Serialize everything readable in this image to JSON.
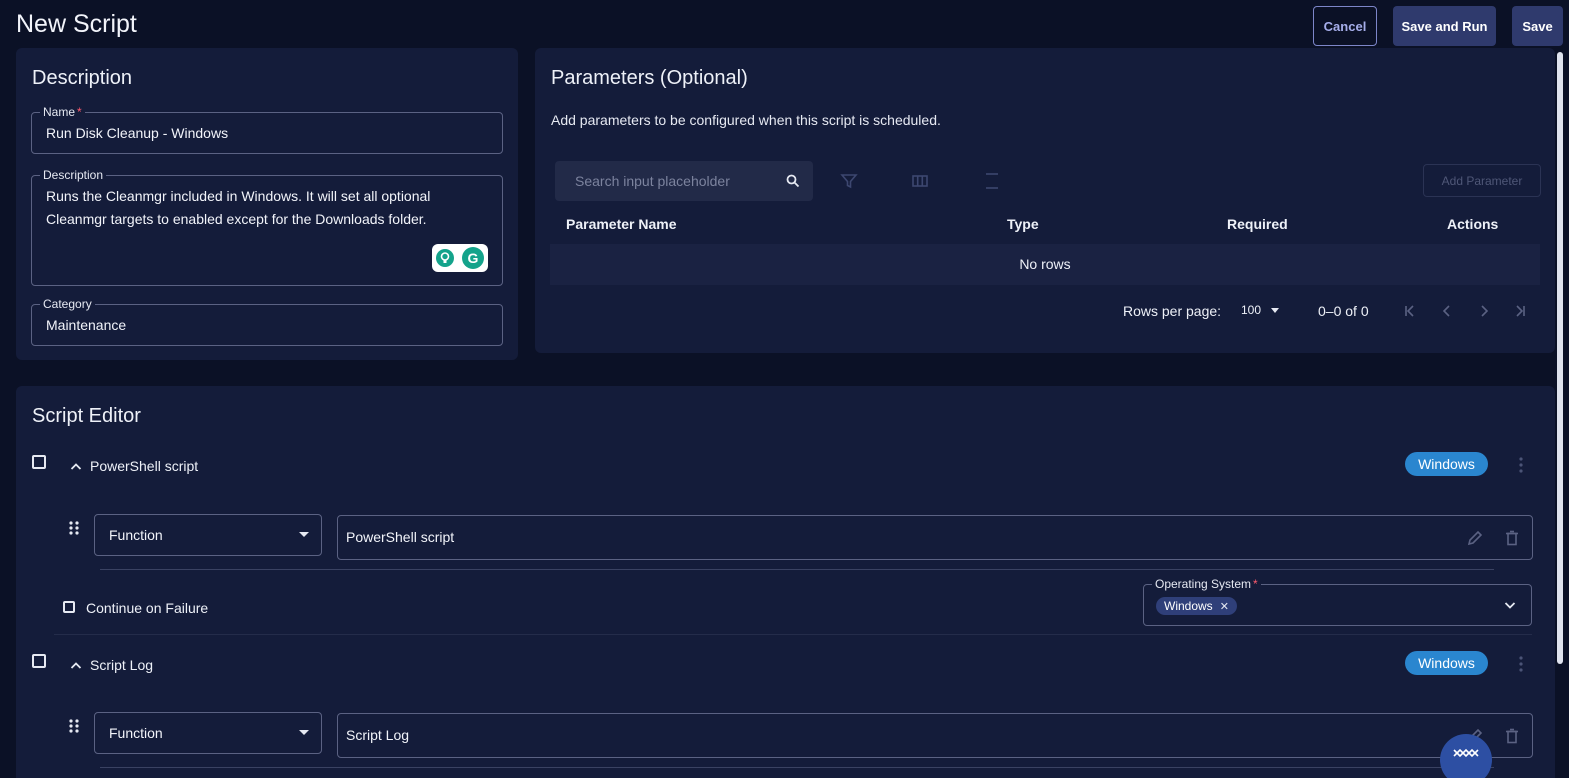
{
  "header": {
    "title": "New Script",
    "cancel_label": "Cancel",
    "save_and_run_label": "Save and Run",
    "save_label": "Save"
  },
  "description_card": {
    "title": "Description",
    "name_label": "Name",
    "required_mark": "*",
    "name_value": "Run Disk Cleanup - Windows",
    "description_label": "Description",
    "description_line1": "Runs the Cleanmgr included in Windows. It will set all optional",
    "description_line2": "Cleanmgr targets to enabled except for the Downloads folder.",
    "category_label": "Category",
    "category_value": "Maintenance",
    "grammarly_letter": "G"
  },
  "parameters_card": {
    "title": "Parameters (Optional)",
    "subtitle": "Add parameters to be configured when this script is scheduled.",
    "search_placeholder": "Search input placeholder",
    "add_parameter_label": "Add Parameter",
    "columns": [
      "Parameter Name",
      "Type",
      "Required",
      "Actions"
    ],
    "empty_text": "No rows",
    "rows_per_page_label": "Rows per page:",
    "rows_per_page_value": "100",
    "range_text": "0–0 of 0"
  },
  "script_editor": {
    "title": "Script Editor",
    "items": [
      {
        "title": "PowerShell script",
        "badge": "Windows",
        "type_value": "Function",
        "name_value": "PowerShell script",
        "continue_on_failure_label": "Continue on Failure",
        "os_label": "Operating System",
        "os_chip": "Windows"
      },
      {
        "title": "Script Log",
        "badge": "Windows",
        "type_value": "Function",
        "name_value": "Script Log"
      }
    ]
  },
  "colors": {
    "background": "#0b1126",
    "card": "#141c3a",
    "primary_button": "#2f3a6d",
    "badge": "#2a86cf",
    "chip": "#2f3f79",
    "required": "#ff5b6e"
  },
  "icons": {
    "search": "search-icon",
    "filter": "filter-icon",
    "columns": "columns-icon",
    "density": "density-icon",
    "first_page": "first-page-icon",
    "prev_page": "prev-page-icon",
    "next_page": "next-page-icon",
    "last_page": "last-page-icon",
    "drag": "drag-handle-icon",
    "edit": "pencil-icon",
    "delete": "trash-icon",
    "kebab": "more-vertical-icon",
    "chevron": "chevron-down-icon"
  }
}
